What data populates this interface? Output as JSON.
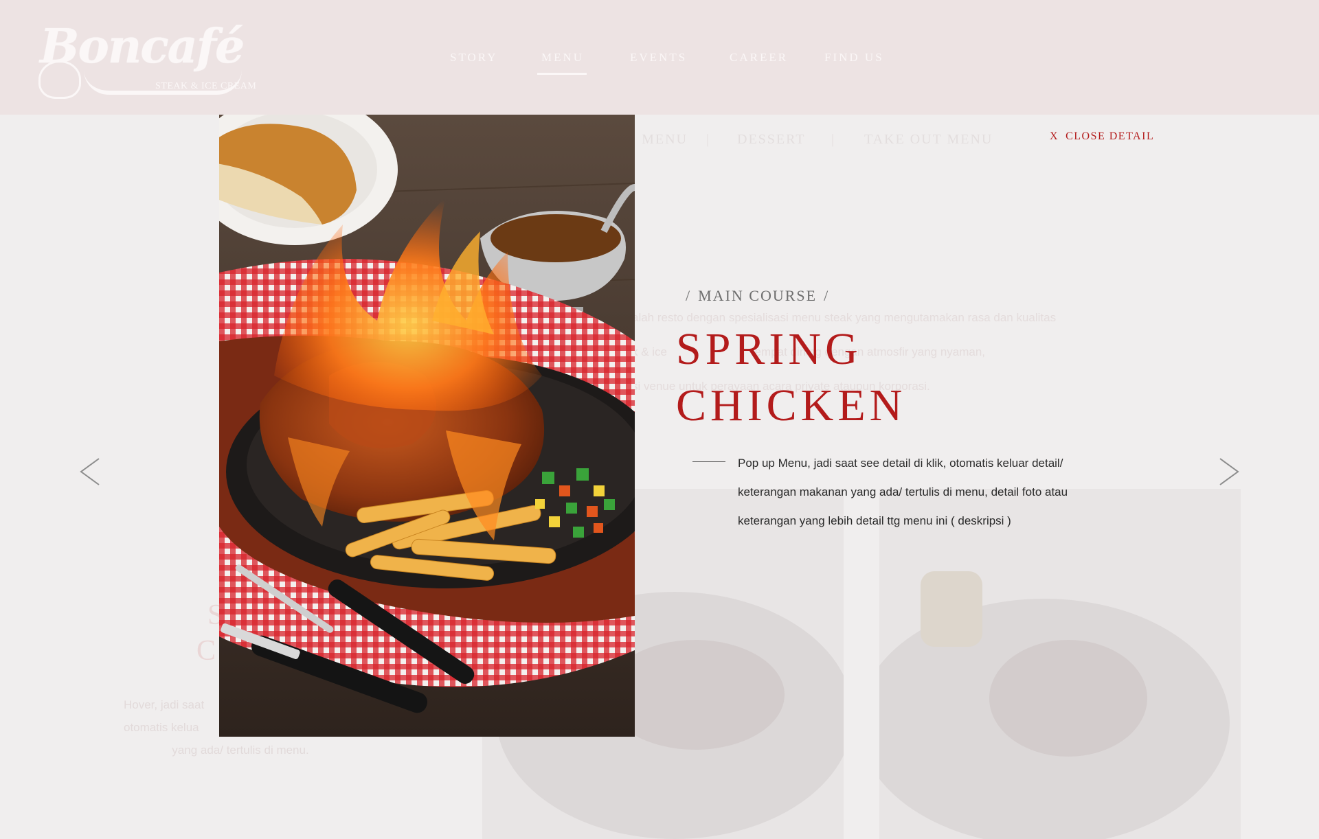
{
  "brand": {
    "name": "Boncafé",
    "tagline": "STEAK & ICE CREAM"
  },
  "nav": {
    "items": [
      "STORY",
      "MENU",
      "EVENTS",
      "CAREER",
      "FIND US"
    ],
    "active": "MENU"
  },
  "subnav": {
    "items": [
      "S MENU",
      "DESSERT",
      "TAKE OUT MENU"
    ]
  },
  "background": {
    "paragraph": [
      "alah resto dengan spesialisasi menu steak yang mengutamakan rasa dan kualitas",
      "k & ice                          tempat dining dengan atmosfir yang nyaman,",
      "si venue untuk perayaan acara private ataupun korporasi."
    ],
    "left_title": [
      "S",
      "C"
    ],
    "left_desc": [
      "Hover, jadi saat",
      "otomatis kelua",
      "yang ada/ tertulis di menu."
    ]
  },
  "detail": {
    "close_icon": "X",
    "close_label": "CLOSE DETAIL",
    "category": "MAIN COURSE",
    "title_line1": "SPRING",
    "title_line2": "CHICKEN",
    "description": [
      "Pop up Menu, jadi saat see detail di klik, otomatis keluar detail/",
      "keterangan makanan yang ada/ tertulis di menu, detail foto atau",
      "keterangan yang lebih detail ttg menu ini ( deskripsi )"
    ]
  },
  "colors": {
    "accent": "#b31b1b",
    "header_bg": "#ede3e3",
    "page_bg": "#f0eeee"
  },
  "icons": {
    "prev": "chevron-left-icon",
    "next": "chevron-right-icon"
  }
}
